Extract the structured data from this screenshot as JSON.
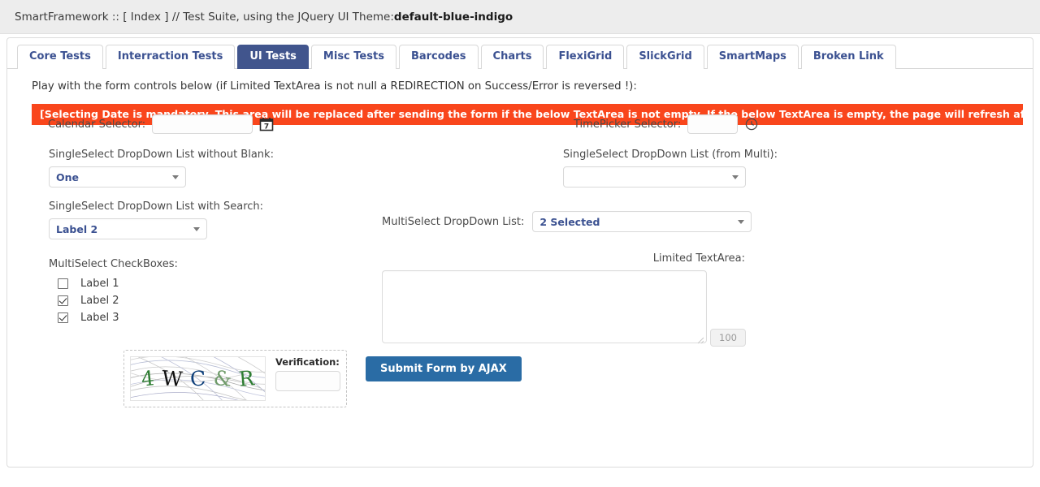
{
  "header": {
    "prefix": "SmartFramework :: [ Index ] // Test Suite, using the JQuery UI Theme: ",
    "theme": "default-blue-indigo"
  },
  "tabs": [
    {
      "label": "Core Tests",
      "active": false
    },
    {
      "label": "Interraction Tests",
      "active": false
    },
    {
      "label": "UI Tests",
      "active": true
    },
    {
      "label": "Misc Tests",
      "active": false
    },
    {
      "label": "Barcodes",
      "active": false
    },
    {
      "label": "Charts",
      "active": false
    },
    {
      "label": "FlexiGrid",
      "active": false
    },
    {
      "label": "SlickGrid",
      "active": false
    },
    {
      "label": "SmartMaps",
      "active": false
    },
    {
      "label": "Broken Link",
      "active": false
    }
  ],
  "intro": "Play with the form controls below (if Limited TextArea is not null a REDIRECTION on Success/Error is reversed !):",
  "alert": "[Selecting Date is mandatory. This area will be replaced after sending the form if the below TextArea is not empty. If the below TextArea is empty, the page will refresh after post !]",
  "form": {
    "calendar": {
      "label": "Calendar Selector:",
      "value": "",
      "placeholder": "",
      "icon": "calendar-icon",
      "icon_day": "7"
    },
    "timepicker": {
      "label": "TimePicker Selector:",
      "value": "",
      "placeholder": "",
      "icon": "clock-icon"
    },
    "select_no_blank": {
      "label": "SingleSelect DropDown List without Blank:",
      "value": "One"
    },
    "select_from_multi": {
      "label": "SingleSelect DropDown List (from Multi):",
      "value": ""
    },
    "select_with_search": {
      "label": "SingleSelect DropDown List with Search:",
      "value": "Label 2"
    },
    "multiselect": {
      "label": "MultiSelect DropDown List:",
      "value": "2 Selected"
    },
    "checkboxes": {
      "label": "MultiSelect CheckBoxes:",
      "items": [
        {
          "label": "Label 1",
          "checked": false
        },
        {
          "label": "Label 2",
          "checked": true
        },
        {
          "label": "Label 3",
          "checked": true
        }
      ]
    },
    "textarea": {
      "label": "Limited TextArea:",
      "value": "",
      "counter": "100"
    },
    "captcha": {
      "characters": [
        {
          "ch": "4",
          "color": "#2e7d32"
        },
        {
          "ch": "W",
          "color": "#111111"
        },
        {
          "ch": "C",
          "color": "#0d3f7a"
        },
        {
          "ch": "&",
          "color": "#6f9b6a"
        },
        {
          "ch": "R",
          "color": "#2e7d32"
        }
      ],
      "verification_label": "Verification:",
      "verification_value": ""
    },
    "submit_label": "Submit Form by AJAX"
  },
  "colors": {
    "accent": "#41558d",
    "alert": "#f9461c",
    "submit": "#2a6ca5",
    "link": "#3b5191"
  }
}
